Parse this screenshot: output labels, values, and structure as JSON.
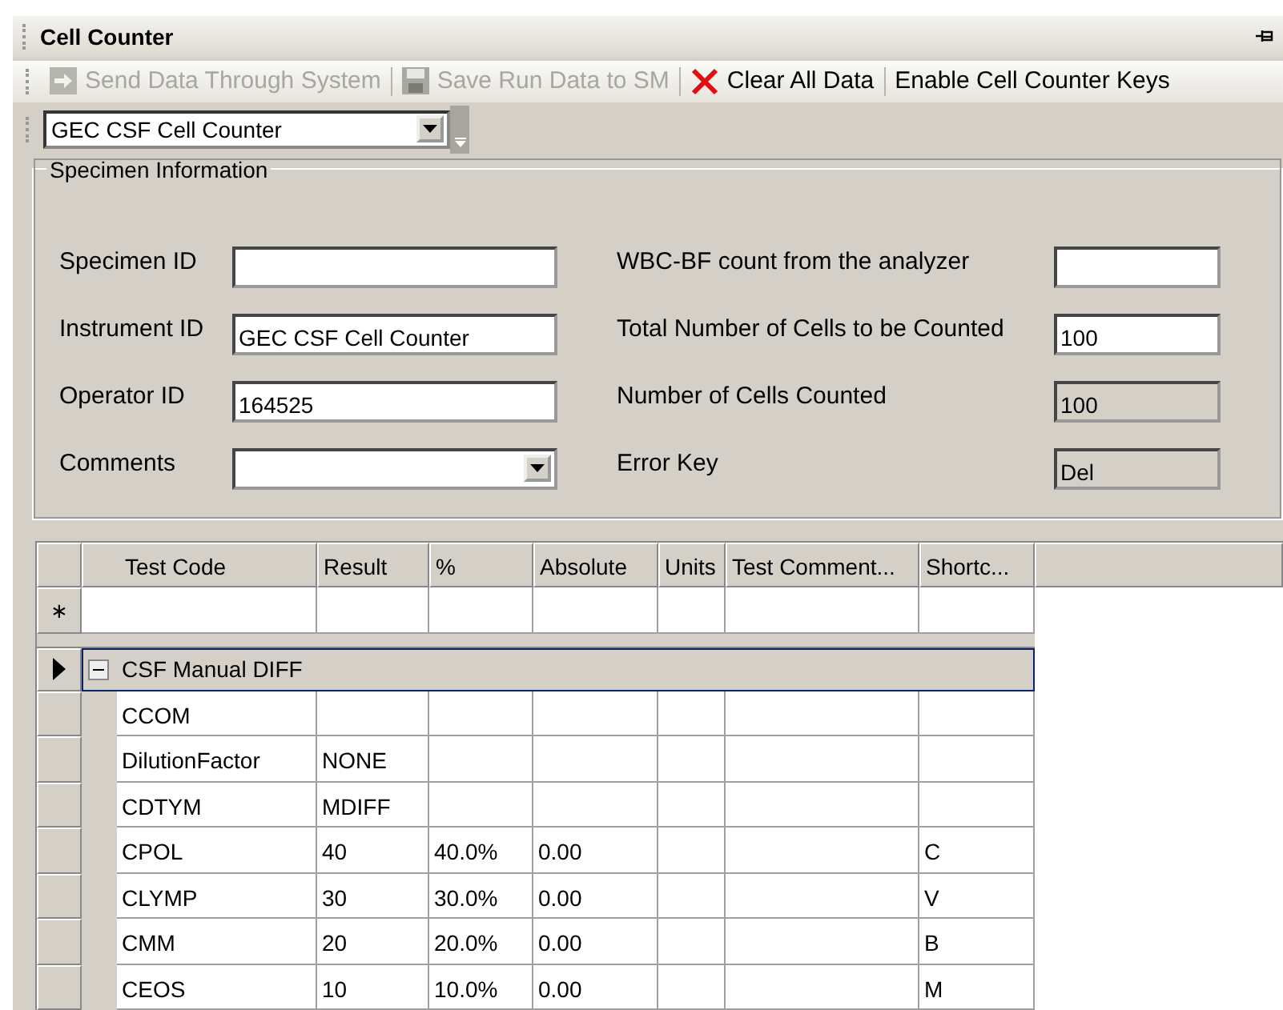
{
  "panel": {
    "title": "Cell Counter"
  },
  "toolbar": [
    {
      "kind": "send",
      "label": "Send Data Through System",
      "disabled": true
    },
    {
      "kind": "save",
      "label": "Save Run Data to SM",
      "disabled": true
    },
    {
      "kind": "clear",
      "label": "Clear All Data",
      "disabled": false
    },
    {
      "kind": "plain",
      "label": "Enable Cell Counter Keys",
      "disabled": false
    }
  ],
  "counter_select": {
    "value": "GEC CSF Cell Counter"
  },
  "specimen": {
    "title": "Specimen Information",
    "left": [
      {
        "kind": "text",
        "label": "Specimen ID"
      },
      {
        "kind": "text",
        "label": "Instrument ID",
        "value": "GEC CSF Cell Counter"
      },
      {
        "kind": "text",
        "label": "Operator ID",
        "value": "164525"
      },
      {
        "kind": "combo",
        "label": "Comments"
      }
    ],
    "right": [
      {
        "label": "WBC-BF count from the analyzer",
        "readonly": false
      },
      {
        "label": "Total Number of Cells to be Counted",
        "value": "100",
        "readonly": false
      },
      {
        "label": "Number of Cells Counted",
        "value": "100",
        "readonly": true
      },
      {
        "label": "Error Key",
        "value": "Del",
        "readonly": true
      }
    ]
  },
  "grid": {
    "columns": [
      "Test Code",
      "Result",
      "%",
      "Absolute",
      "Units",
      "Test Comment...",
      "Shortc..."
    ],
    "new_row_marker": "∗",
    "group": {
      "label": "CSF Manual DIFF",
      "expanded": true,
      "selected": true
    },
    "rows": [
      {
        "cells": [
          "CCOM",
          "",
          "",
          "",
          "",
          "",
          ""
        ]
      },
      {
        "cells": [
          "DilutionFactor",
          "NONE",
          "",
          "",
          "",
          "",
          ""
        ]
      },
      {
        "cells": [
          "CDTYM",
          "MDIFF",
          "",
          "",
          "",
          "",
          ""
        ]
      },
      {
        "cells": [
          "CPOL",
          "40",
          "40.0%",
          "0.00",
          "",
          "",
          "C"
        ]
      },
      {
        "cells": [
          "CLYMP",
          "30",
          "30.0%",
          "0.00",
          "",
          "",
          "V"
        ]
      },
      {
        "cells": [
          "CMM",
          "20",
          "20.0%",
          "0.00",
          "",
          "",
          "B"
        ]
      },
      {
        "cells": [
          "CEOS",
          "10",
          "10.0%",
          "0.00",
          "",
          "",
          "M"
        ]
      }
    ]
  }
}
